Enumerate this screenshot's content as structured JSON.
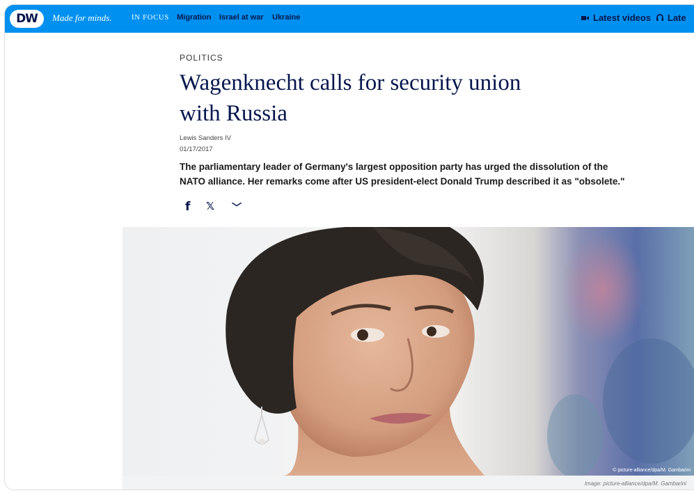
{
  "header": {
    "logo_text": "DW",
    "slogan": "Made for minds.",
    "in_focus_label": "IN FOCUS",
    "focus_links": [
      "Migration",
      "Israel at war",
      "Ukraine"
    ],
    "latest_videos": "Latest videos",
    "latest_audio": "Late",
    "brand_color": "#0091f0",
    "navy": "#05164d"
  },
  "article": {
    "kicker": "POLITICS",
    "headline_line1": "Wagenknecht calls for security union",
    "headline_line2": "with Russia",
    "author": "Lewis Sanders IV",
    "date": "01/17/2017",
    "teaser_line1": "The parliamentary leader of Germany's largest opposition party has urged the dissolution of the",
    "teaser_line2": "NATO alliance. Her remarks come after US president-elect Donald Trump described it as \"obsolete.\"",
    "share_icons": [
      "facebook-icon",
      "x-icon",
      "chevron-down-icon"
    ],
    "share_glyphs": [
      "f",
      "𝕏",
      "﹀"
    ]
  },
  "image": {
    "credit_overlay": "© picture-alliance/dpa/M. Gambarini",
    "caption": "Image: picture-alliance/dpa/M. Gambarini"
  }
}
